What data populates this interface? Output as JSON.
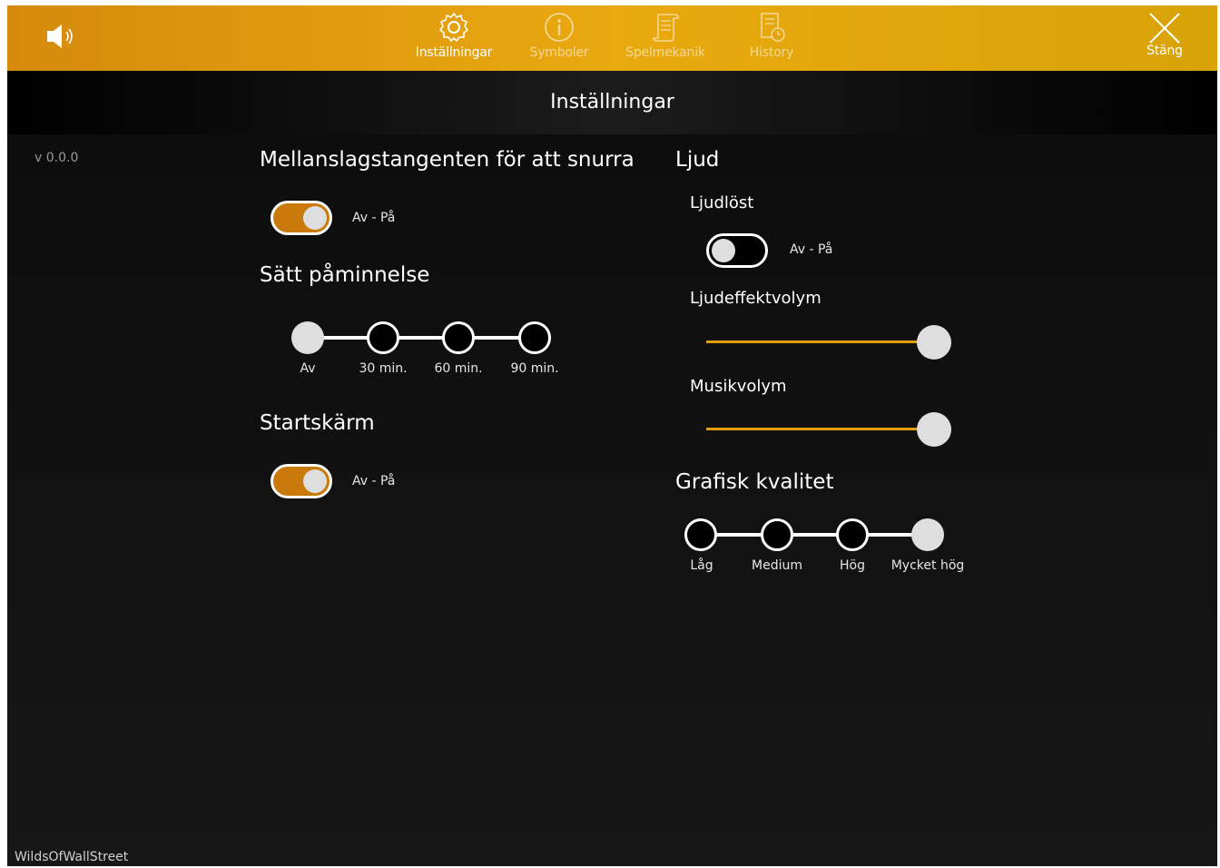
{
  "header": {
    "sound_icon": "speaker-icon",
    "tabs": [
      {
        "label": "Inställningar",
        "icon": "gear-icon",
        "active": true
      },
      {
        "label": "Symboler",
        "icon": "info-icon",
        "active": false
      },
      {
        "label": "Spelmekanik",
        "icon": "scroll-icon",
        "active": false
      },
      {
        "label": "History",
        "icon": "history-icon",
        "active": false
      }
    ],
    "close_label": "Stäng",
    "close_icon": "close-icon"
  },
  "page_title": "Inställningar",
  "version": "v 0.0.0",
  "left": {
    "spacebar": {
      "title": "Mellanslagstangenten för att snurra",
      "toggle_label": "Av - På",
      "on": true
    },
    "reminder": {
      "title": "Sätt påminnelse",
      "options": [
        "Av",
        "30 min.",
        "60 min.",
        "90 min."
      ],
      "selected_index": 0
    },
    "splash": {
      "title": "Startskärm",
      "toggle_label": "Av - På",
      "on": true
    }
  },
  "right": {
    "sound": {
      "title": "Ljud",
      "mute": {
        "title": "Ljudlöst",
        "toggle_label": "Av - På",
        "on": false
      },
      "effects_volume": {
        "title": "Ljudeffektvolym",
        "value": 1.0
      },
      "music_volume": {
        "title": "Musikvolym",
        "value": 1.0
      }
    },
    "graphics": {
      "title": "Grafisk kvalitet",
      "options": [
        "Låg",
        "Medium",
        "Hög",
        "Mycket hög"
      ],
      "selected_index": 3
    }
  },
  "footer": {
    "game_name": "WildsOfWallStreet"
  },
  "colors": {
    "accent": "#e2a00f",
    "toggle_on": "#c97a0a",
    "header_start": "#d58a0c",
    "header_end": "#d8a307"
  }
}
